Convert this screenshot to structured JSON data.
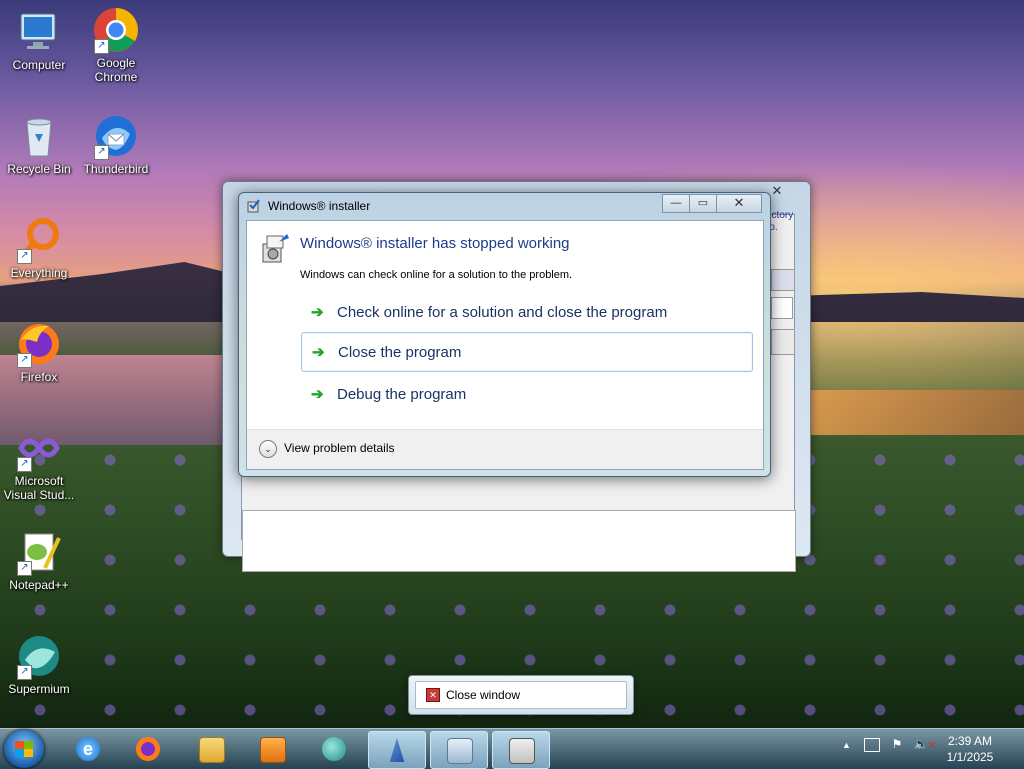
{
  "desktop": {
    "icons": [
      {
        "label": "Computer"
      },
      {
        "label": "Google Chrome"
      },
      {
        "label": "Recycle Bin"
      },
      {
        "label": "Thunderbird"
      },
      {
        "label": "Everything"
      },
      {
        "label": "Firefox"
      },
      {
        "label": "Microsoft Visual Stud..."
      },
      {
        "label": "Notepad++"
      },
      {
        "label": "Supermium"
      }
    ]
  },
  "background_window": {
    "close_glyph": "✕",
    "side_text_line1": "ectory",
    "side_text_line2": "ro."
  },
  "dialog": {
    "title": "Windows® installer",
    "heading": "Windows® installer has stopped working",
    "subtext": "Windows can check online for a solution to the problem.",
    "options": [
      {
        "label": "Check online for a solution and close the program"
      },
      {
        "label": "Close the program"
      },
      {
        "label": "Debug the program"
      }
    ],
    "details_label": "View problem details",
    "minimize_glyph": "—",
    "maximize_glyph": "▭",
    "close_glyph": "✕"
  },
  "taskbar_popup": {
    "label": "Close window"
  },
  "taskbar": {
    "time": "2:39 AM",
    "date": "1/1/2025",
    "tray_expand": "▲"
  },
  "colors": {
    "heading": "#1c3c8c",
    "arrow": "#22a52a",
    "accent_blue": "#1a5ba8"
  }
}
